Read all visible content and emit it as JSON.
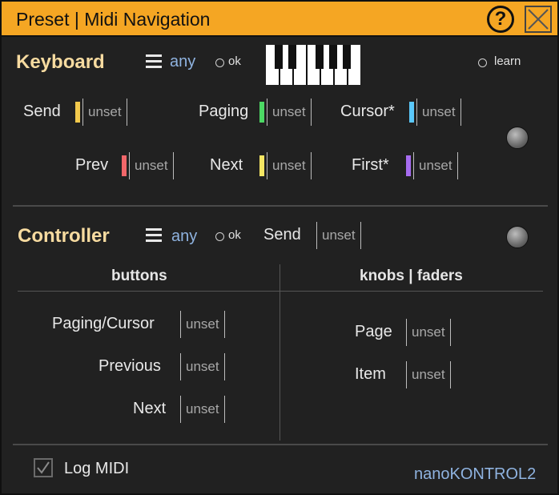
{
  "window": {
    "title": "Preset | Midi Navigation"
  },
  "titlebar": {
    "help_icon": "question-circle-icon",
    "close_icon": "close-x-icon"
  },
  "keyboard": {
    "title": "Keyboard",
    "filter": "any",
    "ok_label": "ok",
    "learn_label": "learn",
    "fields": [
      {
        "label": "Send",
        "value": "unset",
        "color": "#f2c94c"
      },
      {
        "label": "Paging",
        "value": "unset",
        "color": "#4cd964"
      },
      {
        "label": "Cursor*",
        "value": "unset",
        "color": "#5ac8fa"
      },
      {
        "label": "Prev",
        "value": "unset",
        "color": "#f2676a"
      },
      {
        "label": "Next",
        "value": "unset",
        "color": "#f5e663"
      },
      {
        "label": "First*",
        "value": "unset",
        "color": "#a66cf0"
      }
    ]
  },
  "controller": {
    "title": "Controller",
    "filter": "any",
    "ok_label": "ok",
    "send_label": "Send",
    "send_value": "unset",
    "buttons_header": "buttons",
    "knobs_header": "knobs | faders",
    "buttons": [
      {
        "label": "Paging/Cursor",
        "value": "unset"
      },
      {
        "label": "Previous",
        "value": "unset"
      },
      {
        "label": "Next",
        "value": "unset"
      }
    ],
    "knobs": [
      {
        "label": "Page",
        "value": "unset"
      },
      {
        "label": "Item",
        "value": "unset"
      }
    ]
  },
  "footer": {
    "log_label": "Log MIDI",
    "log_checked": true,
    "device": "nanoKONTROL2"
  }
}
